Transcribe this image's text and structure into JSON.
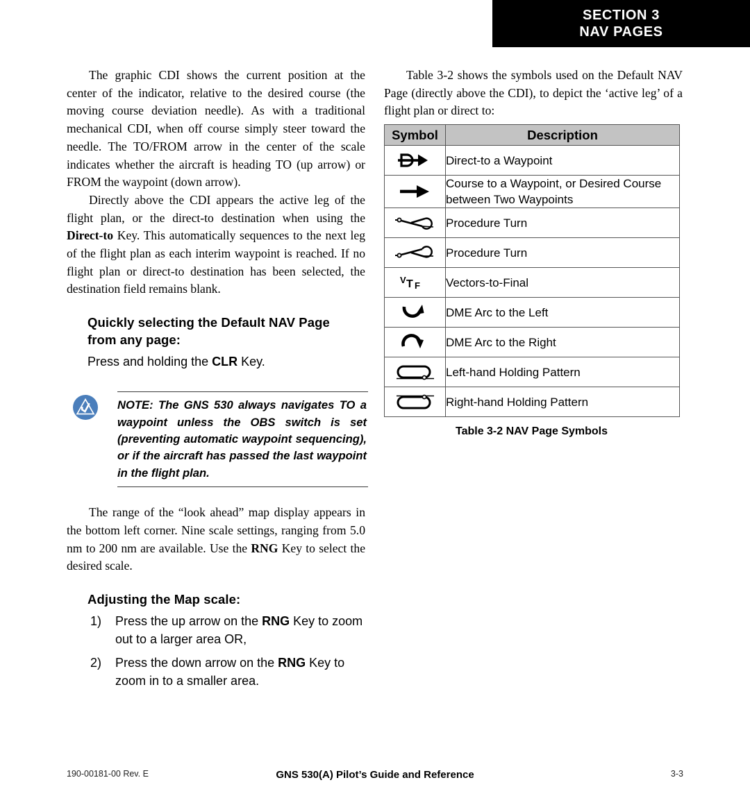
{
  "header": {
    "line1": "SECTION 3",
    "line2": "NAV PAGES"
  },
  "left_column": {
    "paragraph_1_parts": {
      "a": "The graphic CDI shows the current position at the center of the indicator, relative to the desired course (the moving course deviation needle).  As with a traditional mechanical CDI, when off course simply steer toward the needle. The TO/FROM arrow in the center of the scale indicates whether the aircraft is heading TO (up arrow) or FROM the waypoint (down arrow)."
    },
    "paragraph_2_parts": {
      "a": "Directly above the CDI appears the active leg of the flight plan, or the direct-to destination when using the ",
      "bold": "Direct-to",
      "b": " Key.  This automatically sequences to the next leg of the flight plan as each interim waypoint is reached. If no flight plan or direct-to destination has been selected, the destination field remains blank."
    },
    "subhead_1": "Quickly selecting the Default NAV Page from any page:",
    "instruction_1_parts": {
      "a": "Press and holding the ",
      "bold": "CLR",
      "b": " Key."
    },
    "note": {
      "icon_name": "note-caution-icon",
      "text": "NOTE:  The GNS 530 always navigates TO a waypoint unless the OBS switch is set (preventing automatic waypoint sequencing), or if the aircraft has  passed the last waypoint in the flight plan."
    },
    "paragraph_3_parts": {
      "a": "The range of the “look ahead” map display appears in the bottom left corner.  Nine scale settings, ranging from 5.0 nm to 200 nm are available.  Use the ",
      "bold": "RNG",
      "b": " Key to select the desired scale."
    },
    "subhead_2": "Adjusting the Map scale:",
    "steps": [
      {
        "num": "1)",
        "a": "Press the up arrow on the ",
        "bold": "RNG",
        "b": " Key to zoom out to a larger area  OR,"
      },
      {
        "num": "2)",
        "a": "Press the down arrow on the ",
        "bold": "RNG",
        "b": " Key to zoom in to a smaller area."
      }
    ]
  },
  "right_column": {
    "paragraph_1": "Table 3-2 shows the symbols used on the Default NAV Page (directly above the CDI), to depict the ‘active leg’ of a flight plan or direct to:",
    "table": {
      "headers": [
        "Symbol",
        "Description"
      ],
      "rows": [
        {
          "symbol": "direct-to-waypoint-icon",
          "description": "Direct-to a Waypoint"
        },
        {
          "symbol": "course-arrow-icon",
          "description": "Course to a Waypoint, or Desired Course between Two Waypoints"
        },
        {
          "symbol": "procedure-turn-right-icon",
          "description": "Procedure Turn"
        },
        {
          "symbol": "procedure-turn-left-icon",
          "description": "Procedure Turn"
        },
        {
          "symbol": "vectors-to-final-icon",
          "description": "Vectors-to-Final"
        },
        {
          "symbol": "dme-arc-left-icon",
          "description": "DME Arc to the Left"
        },
        {
          "symbol": "dme-arc-right-icon",
          "description": "DME Arc to the Right"
        },
        {
          "symbol": "left-hand-holding-pattern-icon",
          "description": "Left-hand Holding Pattern"
        },
        {
          "symbol": "right-hand-holding-pattern-icon",
          "description": "Right-hand Holding Pattern"
        }
      ],
      "caption": "Table 3-2 NAV Page Symbols"
    }
  },
  "footer": {
    "left": "190-00181-00  Rev. E",
    "center": "GNS 530(A) Pilot’s Guide and Reference",
    "right": "3-3"
  },
  "colors": {
    "header_bg": "#000000",
    "header_text": "#ffffff",
    "table_header_bg": "#c3c3c3",
    "note_icon_blue": "#4a7ebb",
    "rule": "#3b3b3b"
  }
}
